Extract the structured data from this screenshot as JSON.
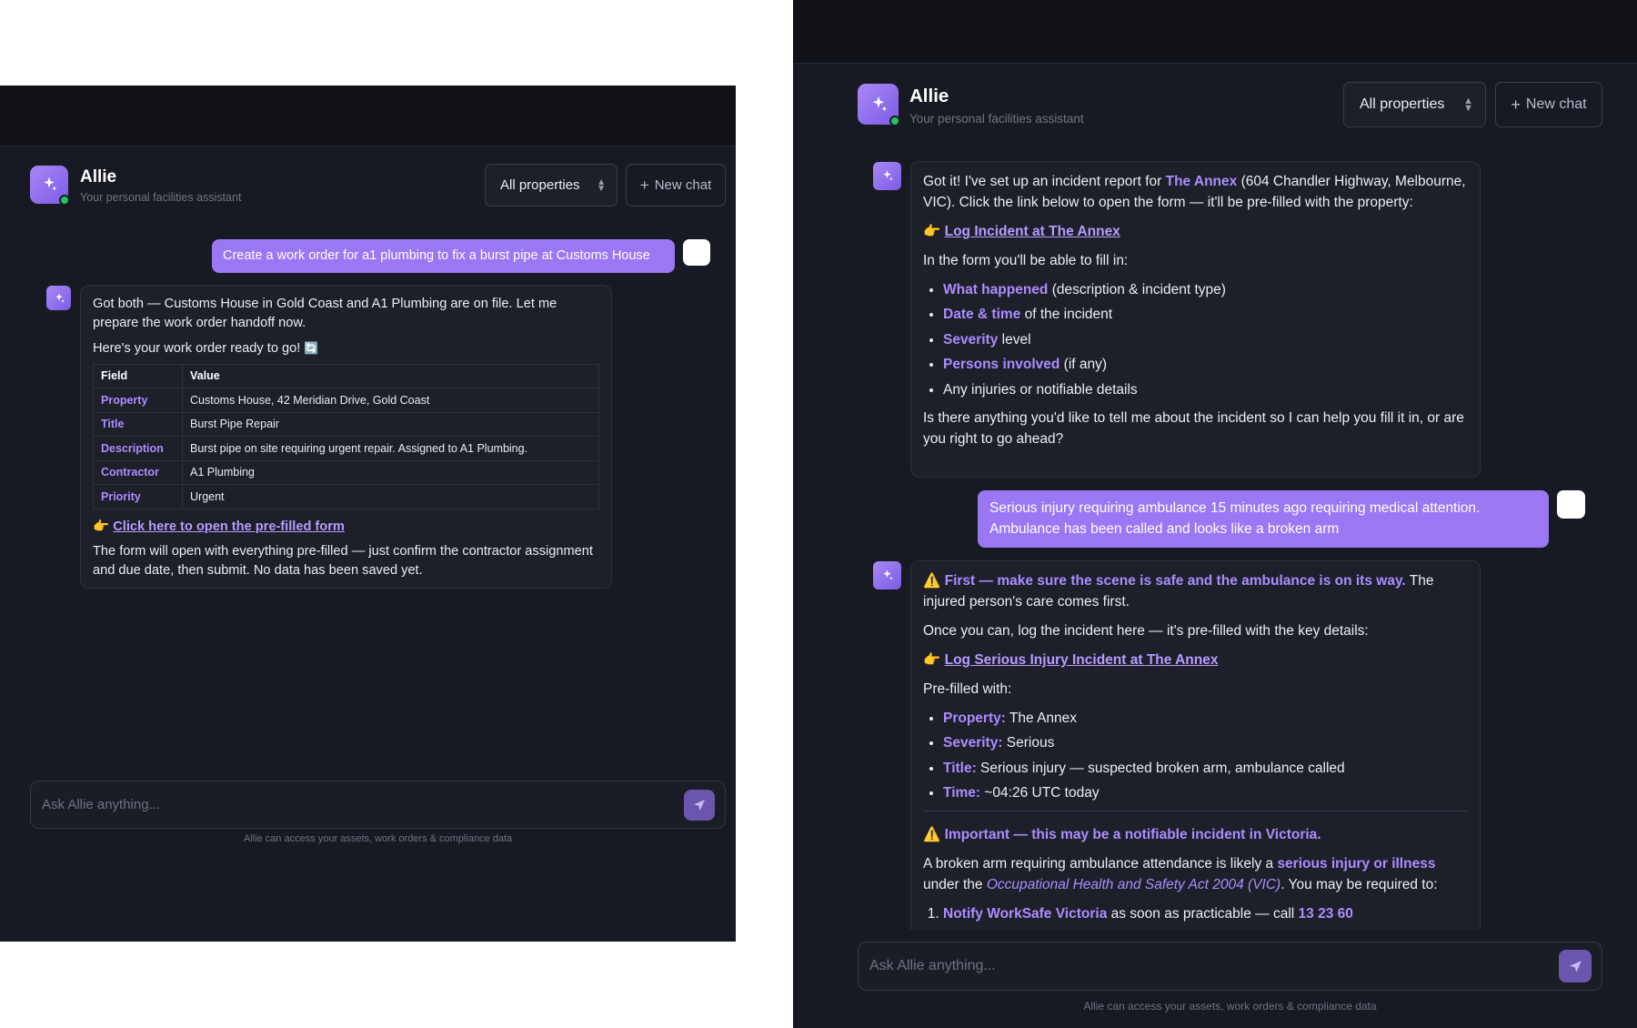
{
  "left": {
    "header": {
      "name": "Allie",
      "subtitle": "Your personal facilities assistant",
      "property_select": "All properties",
      "new_chat": "New chat"
    },
    "user_message": "Create a work order for a1 plumbing to fix a burst pipe at Customs House",
    "assistant": {
      "intro": "Got both — Customs House in Gold Coast and A1 Plumbing are on file. Let me prepare the work order handoff now.",
      "ready": "Here's your work order ready to go!",
      "ready_emoji": "🔄",
      "table_headers": [
        "Field",
        "Value"
      ],
      "table_rows": [
        {
          "field": "Property",
          "value": "Customs House, 42 Meridian Drive, Gold Coast"
        },
        {
          "field": "Title",
          "value": "Burst Pipe Repair"
        },
        {
          "field": "Description",
          "value": "Burst pipe on site requiring urgent repair. Assigned to A1 Plumbing."
        },
        {
          "field": "Contractor",
          "value": "A1 Plumbing"
        },
        {
          "field": "Priority",
          "value": "Urgent"
        }
      ],
      "pointer_emoji": "👉",
      "link": "Click here to open the pre-filled form",
      "outro": "The form will open with everything pre-filled — just confirm the contractor assignment and due date, then submit. No data has been saved yet."
    },
    "input": {
      "placeholder": "Ask Allie anything..."
    },
    "footnote": "Allie can access your assets, work orders & compliance data"
  },
  "right": {
    "header": {
      "name": "Allie",
      "subtitle": "Your personal facilities assistant",
      "property_select": "All properties",
      "new_chat": "New chat"
    },
    "msg1": {
      "intro_a": "Got it! I've set up an incident report for ",
      "intro_hl": "The Annex",
      "intro_b": " (604 Chandler Highway, Melbourne, VIC). Click the link below to open the form — it'll be pre-filled with the property:",
      "pointer_emoji": "👉",
      "link": "Log Incident at The Annex",
      "fill_intro": "In the form you'll be able to fill in:",
      "items": [
        {
          "hl": "What happened",
          "text": " (description & incident type)"
        },
        {
          "hl": "Date & time",
          "text": " of the incident"
        },
        {
          "hl": "Severity",
          "text": " level"
        },
        {
          "hl": "Persons involved",
          "text": " (if any)"
        },
        {
          "hl": "",
          "text": "Any injuries or notifiable details"
        }
      ],
      "question": "Is there anything you'd like to tell me about the incident so I can help you fill it in, or are you right to go ahead?"
    },
    "user_message": "Serious injury requiring ambulance 15 minutes ago requiring medical attention. Ambulance has been called and looks like a broken arm",
    "msg2": {
      "warn_emoji": "⚠️",
      "first_hl": "First — make sure the scene is safe and the ambulance is on its way.",
      "first_rest": " The injured person's care comes first.",
      "log_intro": "Once you can, log the incident here — it's pre-filled with the key details:",
      "pointer_emoji": "👉",
      "link": "Log Serious Injury Incident at The Annex",
      "prefilled_label": "Pre-filled with:",
      "prefilled": [
        {
          "k": "Property:",
          "v": " The Annex"
        },
        {
          "k": "Severity:",
          "v": " Serious"
        },
        {
          "k": "Title:",
          "v": " Serious injury — suspected broken arm, ambulance called"
        },
        {
          "k": "Time:",
          "v": " ~04:26 UTC today"
        }
      ],
      "important_hl": "Important — this may be a notifiable incident in Victoria.",
      "notif_a": "A broken arm requiring ambulance attendance is likely a ",
      "notif_hl": "serious injury or illness",
      "notif_b": " under the ",
      "notif_act": "Occupational Health and Safety Act 2004 (VIC)",
      "notif_c": ". You may be required to:",
      "step1_hl": "Notify WorkSafe Victoria",
      "step1_text": " as soon as practicable — call ",
      "step1_phone": "13 23 60"
    },
    "input": {
      "placeholder": "Ask Allie anything..."
    },
    "footnote": "Allie can access your assets, work orders & compliance data"
  }
}
